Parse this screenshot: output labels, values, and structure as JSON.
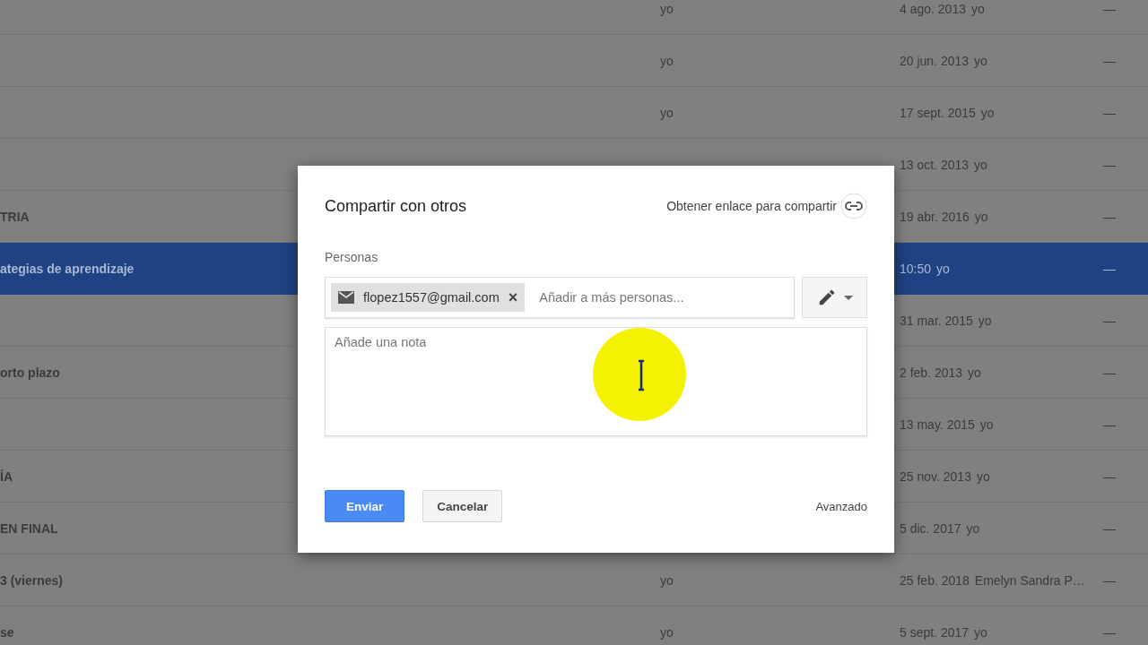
{
  "file_list": {
    "rows": [
      {
        "owner": "yo",
        "modified": "4 ago. 2013",
        "modified_by": "yo",
        "size": "—",
        "selected": false
      },
      {
        "owner": "yo",
        "modified": "20 jun. 2013",
        "modified_by": "yo",
        "size": "—",
        "selected": false
      },
      {
        "owner": "yo",
        "modified": "17 sept. 2015",
        "modified_by": "yo",
        "size": "—",
        "selected": false
      },
      {
        "modified": "13 oct. 2013",
        "modified_by": "yo",
        "size": "—",
        "selected": false
      },
      {
        "name": "TRIA",
        "modified": "19 abr. 2016",
        "modified_by": "yo",
        "size": "—",
        "selected": false
      },
      {
        "name": "ategias de aprendizaje",
        "modified": "10:50",
        "modified_by": "yo",
        "size": "—",
        "selected": true
      },
      {
        "modified": "31 mar. 2015",
        "modified_by": "yo",
        "size": "—",
        "selected": false
      },
      {
        "name": "orto plazo",
        "modified": "2 feb. 2013",
        "modified_by": "yo",
        "size": "—",
        "selected": false
      },
      {
        "modified": "13 may. 2015",
        "modified_by": "yo",
        "size": "—",
        "selected": false
      },
      {
        "name": "ÍA",
        "modified": "25 nov. 2013",
        "modified_by": "yo",
        "size": "—",
        "selected": false
      },
      {
        "name": "EN FINAL",
        "modified": "5 dic. 2017",
        "modified_by": "yo",
        "size": "—",
        "selected": false
      },
      {
        "name": "3 (viernes)",
        "owner": "yo",
        "modified": "25 feb. 2018",
        "modified_by": "Emelyn Sandra P…",
        "size": "—",
        "selected": false
      },
      {
        "name": "se",
        "owner": "yo",
        "modified": "5 sept. 2017",
        "modified_by": "yo",
        "size": "—",
        "selected": false
      }
    ]
  },
  "share_dialog": {
    "title": "Compartir con otros",
    "link_label": "Obtener enlace para compartir",
    "people_label": "Personas",
    "chips": [
      {
        "email": "flopez1557@gmail.com",
        "remove": "×"
      }
    ],
    "people_placeholder": "Añadir a más personas...",
    "note_placeholder": "Añade una nota",
    "buttons": [
      {
        "label": "Enviar",
        "kind": "primary"
      },
      {
        "label": "Cancelar",
        "kind": "secondary"
      }
    ],
    "advanced": "Avanzado"
  }
}
